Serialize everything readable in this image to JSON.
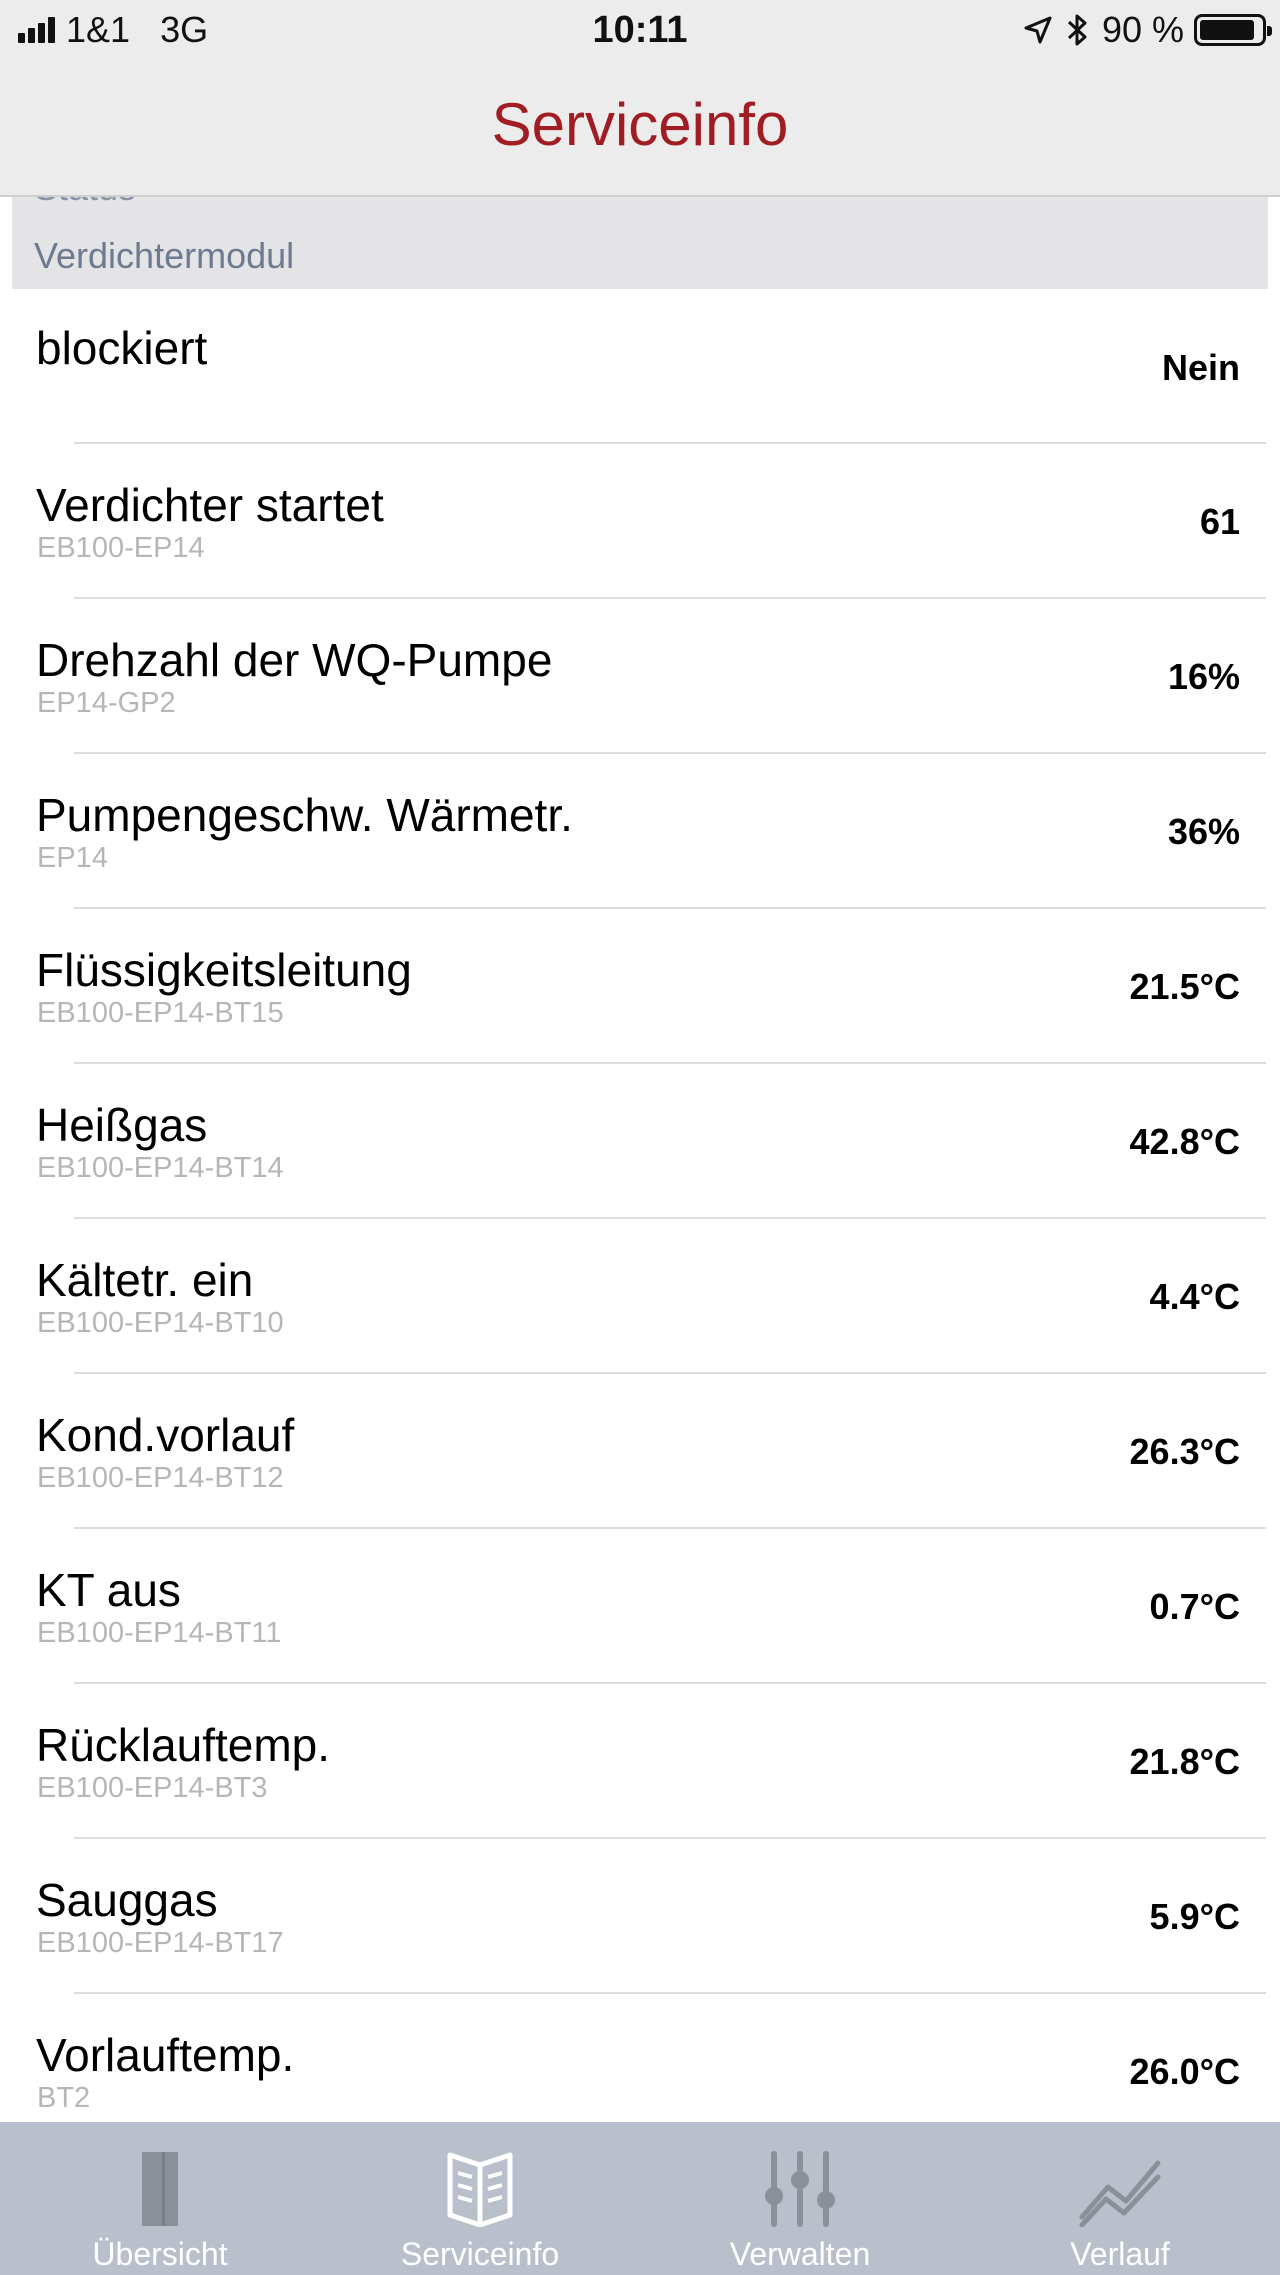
{
  "status_bar": {
    "carrier": "1&1",
    "network": "3G",
    "time": "10:11",
    "battery": "90 %",
    "battery_level": 0.9
  },
  "nav": {
    "title": "Serviceinfo"
  },
  "section": {
    "prev_label": "Status",
    "title": "Verdichtermodul"
  },
  "rows": [
    {
      "title": "blockiert",
      "subtitle": "",
      "value": "Nein"
    },
    {
      "title": "Verdichter startet",
      "subtitle": "EB100-EP14",
      "value": "61"
    },
    {
      "title": "Drehzahl der WQ-Pumpe",
      "subtitle": "EP14-GP2",
      "value": "16%"
    },
    {
      "title": "Pumpengeschw. Wärmetr.",
      "subtitle": "EP14",
      "value": "36%"
    },
    {
      "title": "Flüssigkeitsleitung",
      "subtitle": "EB100-EP14-BT15",
      "value": "21.5°C"
    },
    {
      "title": "Heißgas",
      "subtitle": "EB100-EP14-BT14",
      "value": "42.8°C"
    },
    {
      "title": "Kältetr. ein",
      "subtitle": "EB100-EP14-BT10",
      "value": "4.4°C"
    },
    {
      "title": "Kond.vorlauf",
      "subtitle": "EB100-EP14-BT12",
      "value": "26.3°C"
    },
    {
      "title": "KT aus",
      "subtitle": "EB100-EP14-BT11",
      "value": "0.7°C"
    },
    {
      "title": "Rücklauftemp.",
      "subtitle": "EB100-EP14-BT3",
      "value": "21.8°C"
    },
    {
      "title": "Sauggas",
      "subtitle": "EB100-EP14-BT17",
      "value": "5.9°C"
    },
    {
      "title": "Vorlauftemp.",
      "subtitle": "BT2",
      "value": "26.0°C"
    }
  ],
  "tabs": [
    {
      "label": "Übersicht",
      "icon": "door-icon",
      "active": false
    },
    {
      "label": "Serviceinfo",
      "icon": "book-icon",
      "active": true
    },
    {
      "label": "Verwalten",
      "icon": "sliders-icon",
      "active": false
    },
    {
      "label": "Verlauf",
      "icon": "chart-line-icon",
      "active": false
    }
  ],
  "colors": {
    "accent": "#a11d24",
    "tab_bar": "#b9bfcb",
    "tab_icon_inactive": "#8a8f98",
    "tab_icon_active": "#ffffff"
  }
}
